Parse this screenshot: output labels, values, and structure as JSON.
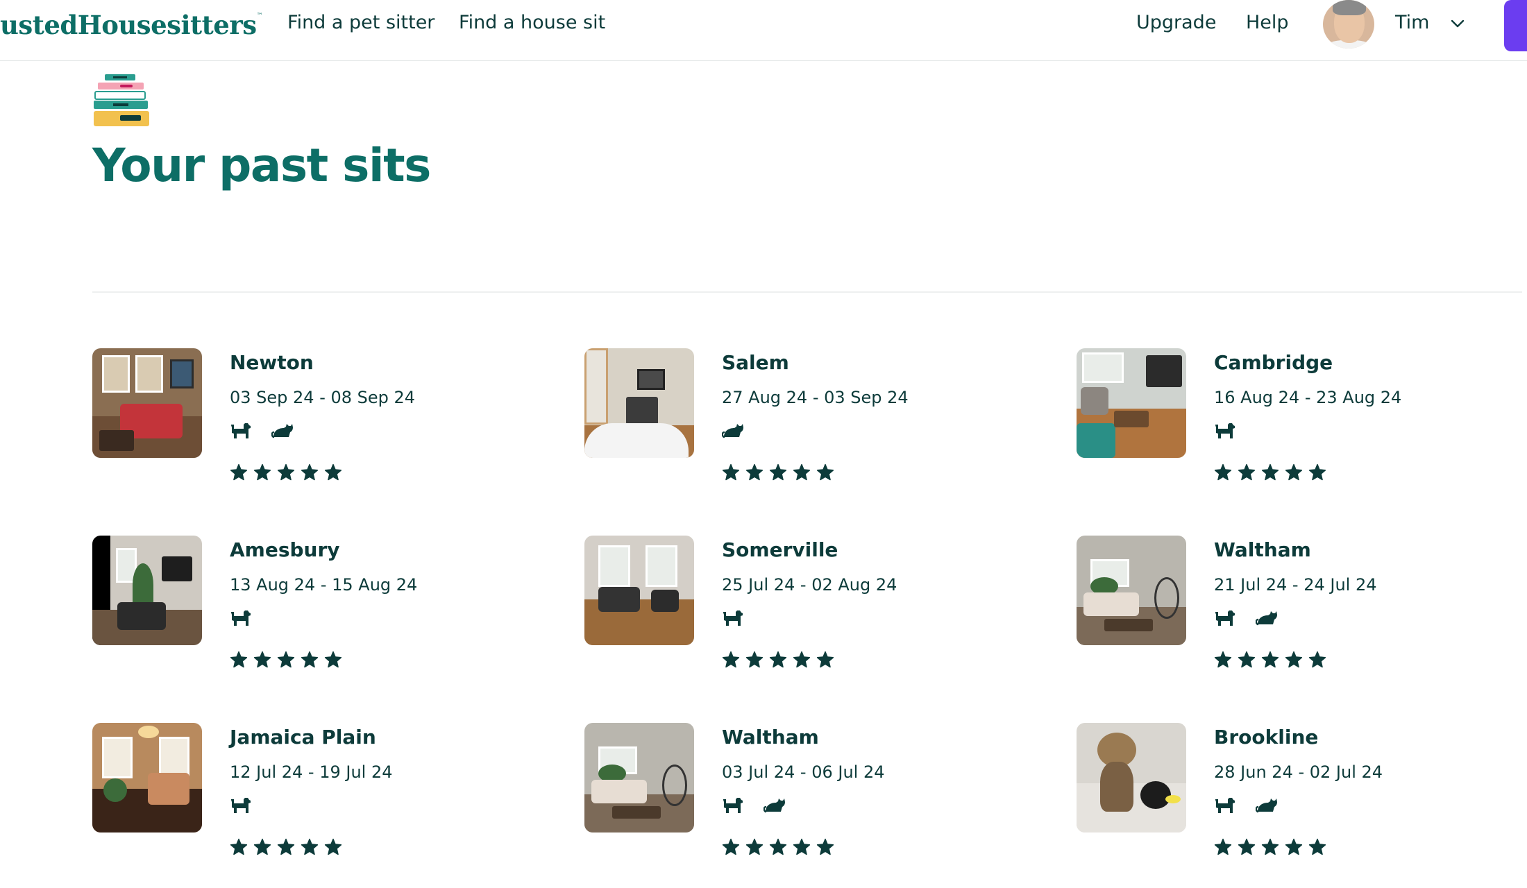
{
  "header": {
    "logo": "ustedHousesitters",
    "logo_tm": "™",
    "nav": [
      "Find a pet sitter",
      "Find a house sit"
    ],
    "upgrade": "Upgrade",
    "help": "Help",
    "user_name": "Tim"
  },
  "page": {
    "title": "Your past sits"
  },
  "colors": {
    "brand_teal": "#0d6e66",
    "text_dark": "#0d3b3a",
    "accent_purple": "#6b3df0"
  },
  "sits": [
    {
      "city": "Newton",
      "dates": "03 Sep 24 - 08 Sep 24",
      "pets": [
        "dog-icon",
        "cat-icon"
      ],
      "rating": 5
    },
    {
      "city": "Salem",
      "dates": "27 Aug 24 - 03 Sep 24",
      "pets": [
        "cat-icon"
      ],
      "rating": 5
    },
    {
      "city": "Cambridge",
      "dates": "16 Aug 24 - 23 Aug 24",
      "pets": [
        "dog-icon"
      ],
      "rating": 5
    },
    {
      "city": "Amesbury",
      "dates": "13 Aug 24 - 15 Aug 24",
      "pets": [
        "dog-icon"
      ],
      "rating": 5
    },
    {
      "city": "Somerville",
      "dates": "25 Jul 24 - 02 Aug 24",
      "pets": [
        "dog-icon"
      ],
      "rating": 5
    },
    {
      "city": "Waltham",
      "dates": "21 Jul 24 - 24 Jul 24",
      "pets": [
        "dog-icon",
        "cat-icon"
      ],
      "rating": 5
    },
    {
      "city": "Jamaica Plain",
      "dates": "12 Jul 24 - 19 Jul 24",
      "pets": [
        "dog-icon"
      ],
      "rating": 5
    },
    {
      "city": "Waltham",
      "dates": "03 Jul 24 - 06 Jul 24",
      "pets": [
        "dog-icon",
        "cat-icon"
      ],
      "rating": 5
    },
    {
      "city": "Brookline",
      "dates": "28 Jun 24 - 02 Jul 24",
      "pets": [
        "dog-icon",
        "cat-icon"
      ],
      "rating": 5
    }
  ]
}
